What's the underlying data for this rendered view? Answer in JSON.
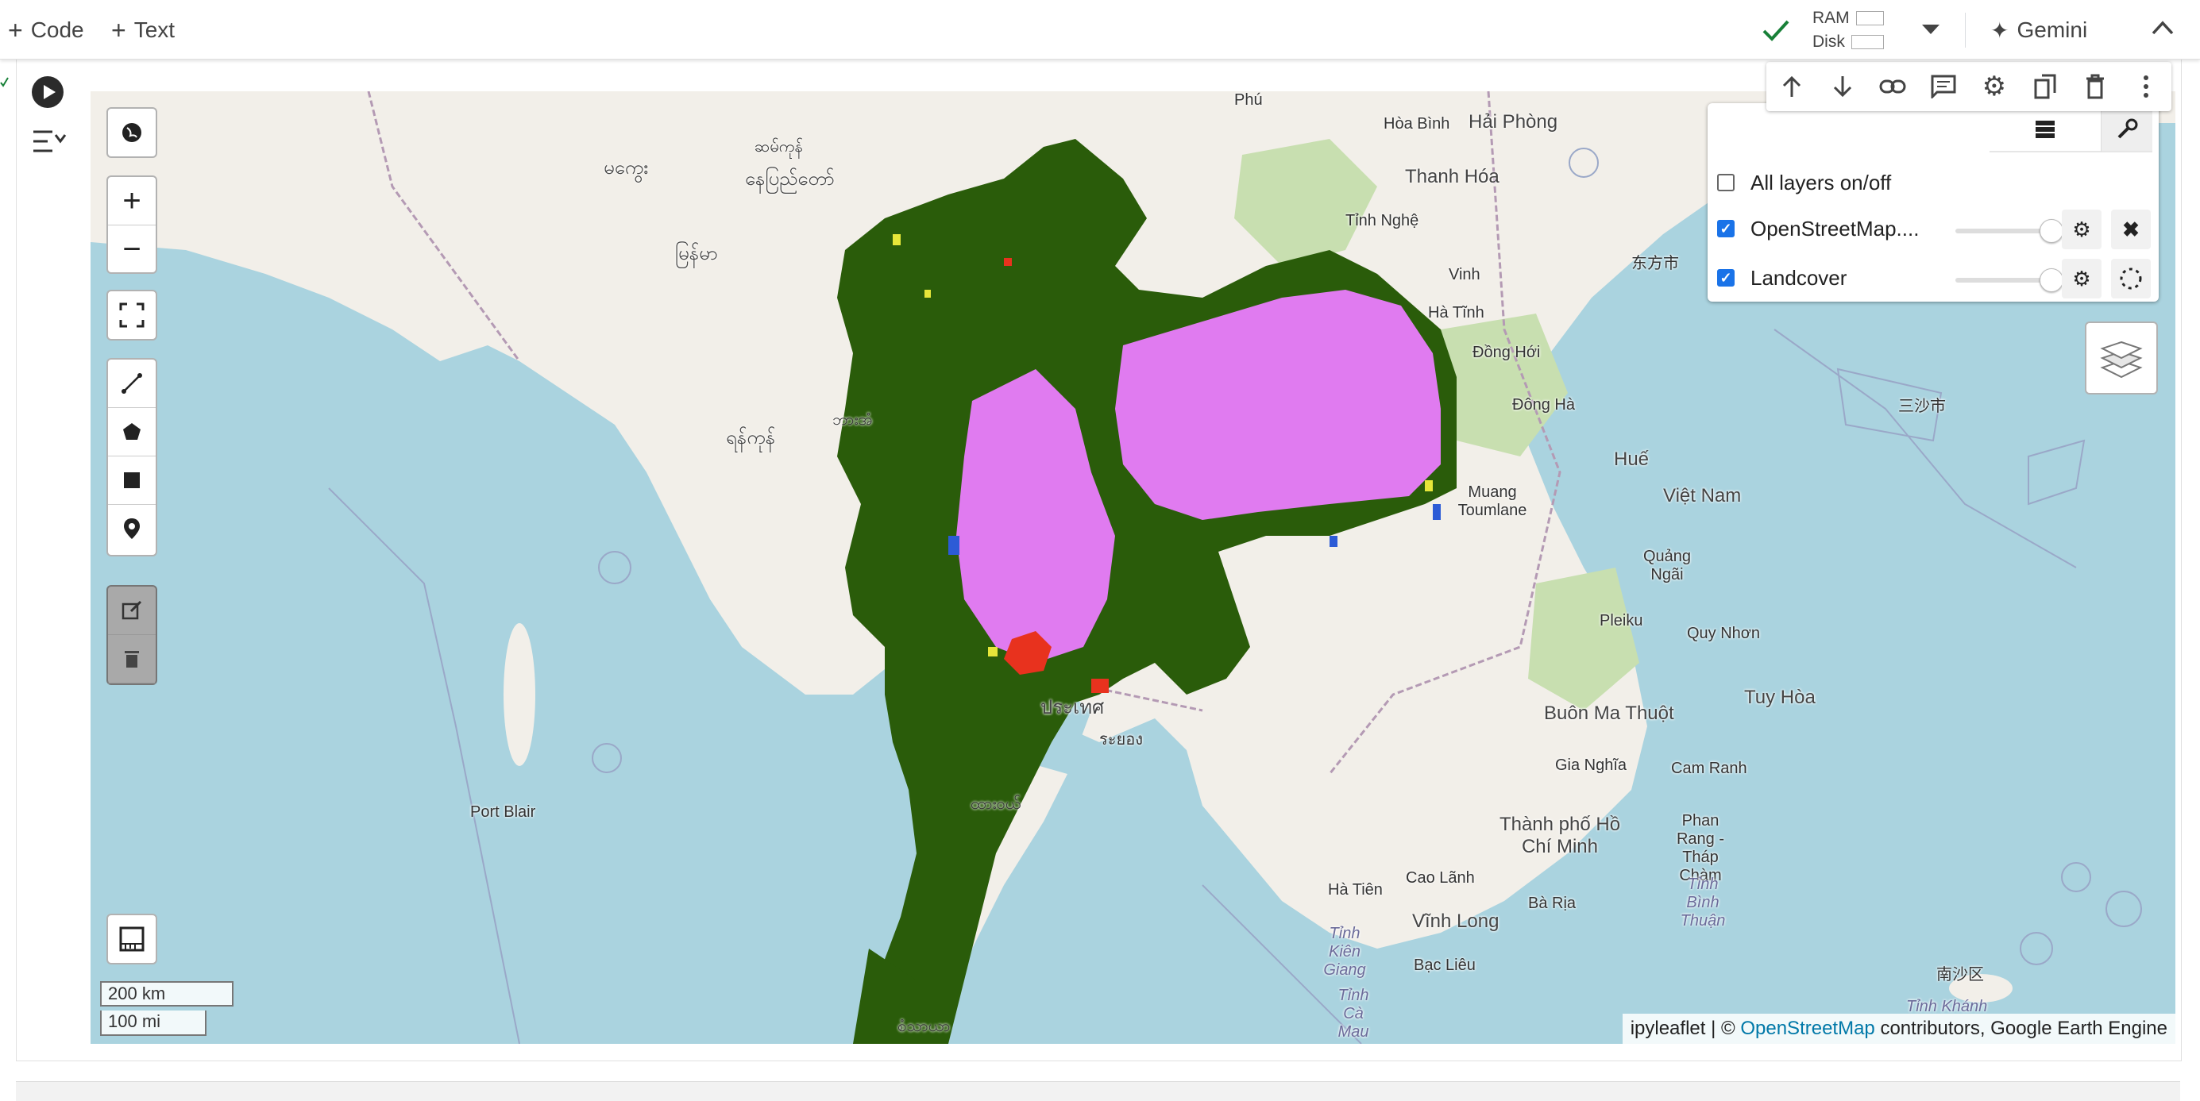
{
  "colab": {
    "add_code_label": "Code",
    "add_text_label": "Text",
    "ram_label": "RAM",
    "disk_label": "Disk",
    "gemini_label": "Gemini"
  },
  "layer_panel": {
    "all_layers_label": "All layers on/off",
    "all_layers_checked": false,
    "layers": [
      {
        "name": "OpenStreetMap....",
        "checked": true,
        "opacity": 1.0
      },
      {
        "name": "Landcover",
        "checked": true,
        "opacity": 1.0
      }
    ]
  },
  "scale": {
    "km_label": "200 km",
    "mi_label": "100 mi"
  },
  "attribution": {
    "prefix": "ipyleaflet | © ",
    "link_text": "OpenStreetMap",
    "suffix": " contributors, Google Earth Engine"
  },
  "map_labels": [
    "Phú",
    "Hòa Bình",
    "Hải Phòng",
    "Thanh Hóa",
    "Tỉnh Nghệ",
    "Vinh",
    "Hà Tĩnh",
    "Đồng Hới",
    "Đông Hà",
    "Huế",
    "Việt Nam",
    "Muang Toumlane",
    "Quảng Ngãi",
    "Pleiku",
    "Quy Nhơn",
    "Tuy Hòa",
    "Buôn Ma Thuột",
    "Gia Nghĩa",
    "Cam Ranh",
    "Thành phố Hồ Chí Minh",
    "Phan Rang - Tháp Chàm",
    "Tỉnh Bình Thuận",
    "Hà Tiên",
    "Cao Lãnh",
    "Bà Rịa",
    "Vĩnh Long",
    "Tỉnh Kiên Giang",
    "Bạc Liêu",
    "Tỉnh Cà Mau",
    "Port Blair",
    "三沙市",
    "东方市",
    "南沙区",
    "Tỉnh Khánh",
    "ประเทศ",
    "ระยอง",
    "မြန်မာ",
    "ရန်ကုန်",
    "နေပြည်တော်",
    "ဘားအံ",
    "ထားဝယ်",
    "မကွေး",
    "ဆမ်ကုန်",
    "စံသာယာ"
  ],
  "landcover_colors": {
    "forest": "#2a5c0a",
    "cropland": "#e07bf0",
    "urban": "#e8321e",
    "water": "#2c5bd6",
    "grass": "#e6e63a"
  },
  "colors": {
    "ocean": "#aad3df",
    "land": "#f2efe9",
    "park": "#c8dfb0",
    "accent": "#1a73e8",
    "check": "#188038"
  }
}
